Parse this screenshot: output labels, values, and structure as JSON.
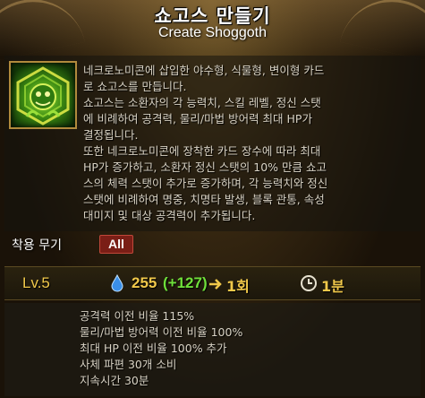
{
  "skill": {
    "title": "쇼고스 만들기",
    "subtitle": "Create Shoggoth",
    "icon": "shoggoth-skill-icon",
    "description": "네크로노미콘에 삽입한 야수형, 식물형, 변이형 카드\n로 쇼고스를 만듭니다.\n쇼고스는 소환자의 각 능력치, 스킬 레벨, 정신 스탯\n에 비례하여 공격력, 물리/마법 방어력 최대 HP가\n결정됩니다.\n또한 네크로노미콘에 장착한 카드 장수에 따라 최대\nHP가 증가하고, 소환자 정신 스탯의 10% 만큼 쇼고\n스의 체력 스탯이 추가로 증가하며, 각 능력치와 정신\n스탯에 비례하여 명중, 치명타 발생, 블록 관통, 속성\n대미지 및 대상 공격력이 추가됩니다."
  },
  "weapon": {
    "label": "착용 무기",
    "badge": "All"
  },
  "stats": {
    "level": "Lv.5",
    "mp_cost": "255",
    "mp_bonus": "(+127)",
    "uses": "1회",
    "cooldown": "1분"
  },
  "effects": [
    "공격력 이전 비율 115%",
    "물리/마법 방어력 이전 비율 100%",
    "최대 HP 이전 비율 100% 추가",
    "사체 파편 30개 소비",
    "지속시간 30분"
  ],
  "colors": {
    "gold": "#f0c84a",
    "bonus_green": "#6fe03a",
    "badge_red": "#7a1e16",
    "text": "#d8d2c4"
  }
}
